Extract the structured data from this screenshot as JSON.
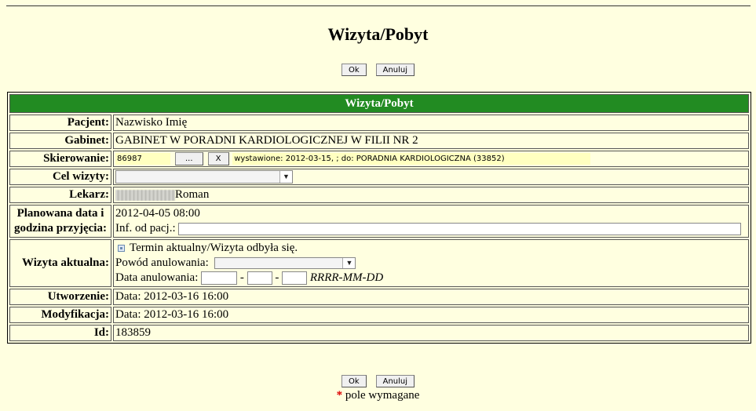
{
  "page": {
    "title": "Wizyta/Pobyt"
  },
  "buttons": {
    "ok_label": "Ok",
    "cancel_label": "Anuluj"
  },
  "table": {
    "header": "Wizyta/Pobyt",
    "patient": {
      "label": "Pacjent:",
      "value": "Nazwisko Imię"
    },
    "clinic": {
      "label": "Gabinet:",
      "value": "GABINET W PORADNI KARDIOLOGICZNEJ W FILII NR 2"
    },
    "referral": {
      "label": "Skierowanie:",
      "number": "86987",
      "browse_label": "...",
      "clear_label": "X",
      "info": "wystawione: 2012-03-15, ; do: PORADNIA KARDIOLOGICZNA  (33852)"
    },
    "visit_purpose": {
      "label": "Cel wizyty:",
      "selected": ""
    },
    "doctor": {
      "label": "Lekarz:",
      "value": "Roman"
    },
    "planned": {
      "label_line1": "Planowana data i",
      "label_line2": "godzina przyjęcia:",
      "datetime": "2012-04-05 08:00",
      "info_label": "Inf. od pacj.:",
      "info_value": ""
    },
    "current": {
      "label": "Wizyta aktualna:",
      "checkbox_label": "Termin aktualny/Wizyta odbyła się.",
      "checked": true,
      "cancel_reason_label": "Powód anulowania:",
      "cancel_reason_selected": "",
      "cancel_date_label": "Data anulowania:",
      "cancel_date_sep": "-",
      "cancel_date_format": "RRRR-MM-DD"
    },
    "created": {
      "label": "Utworzenie:",
      "value": "Data: 2012-03-16 16:00"
    },
    "modified": {
      "label": "Modyfikacja:",
      "value": "Data: 2012-03-16 16:00"
    },
    "id": {
      "label": "Id:",
      "value": "183859"
    }
  },
  "footer": {
    "required_marker": "*",
    "required_text": "pole wymagane"
  }
}
